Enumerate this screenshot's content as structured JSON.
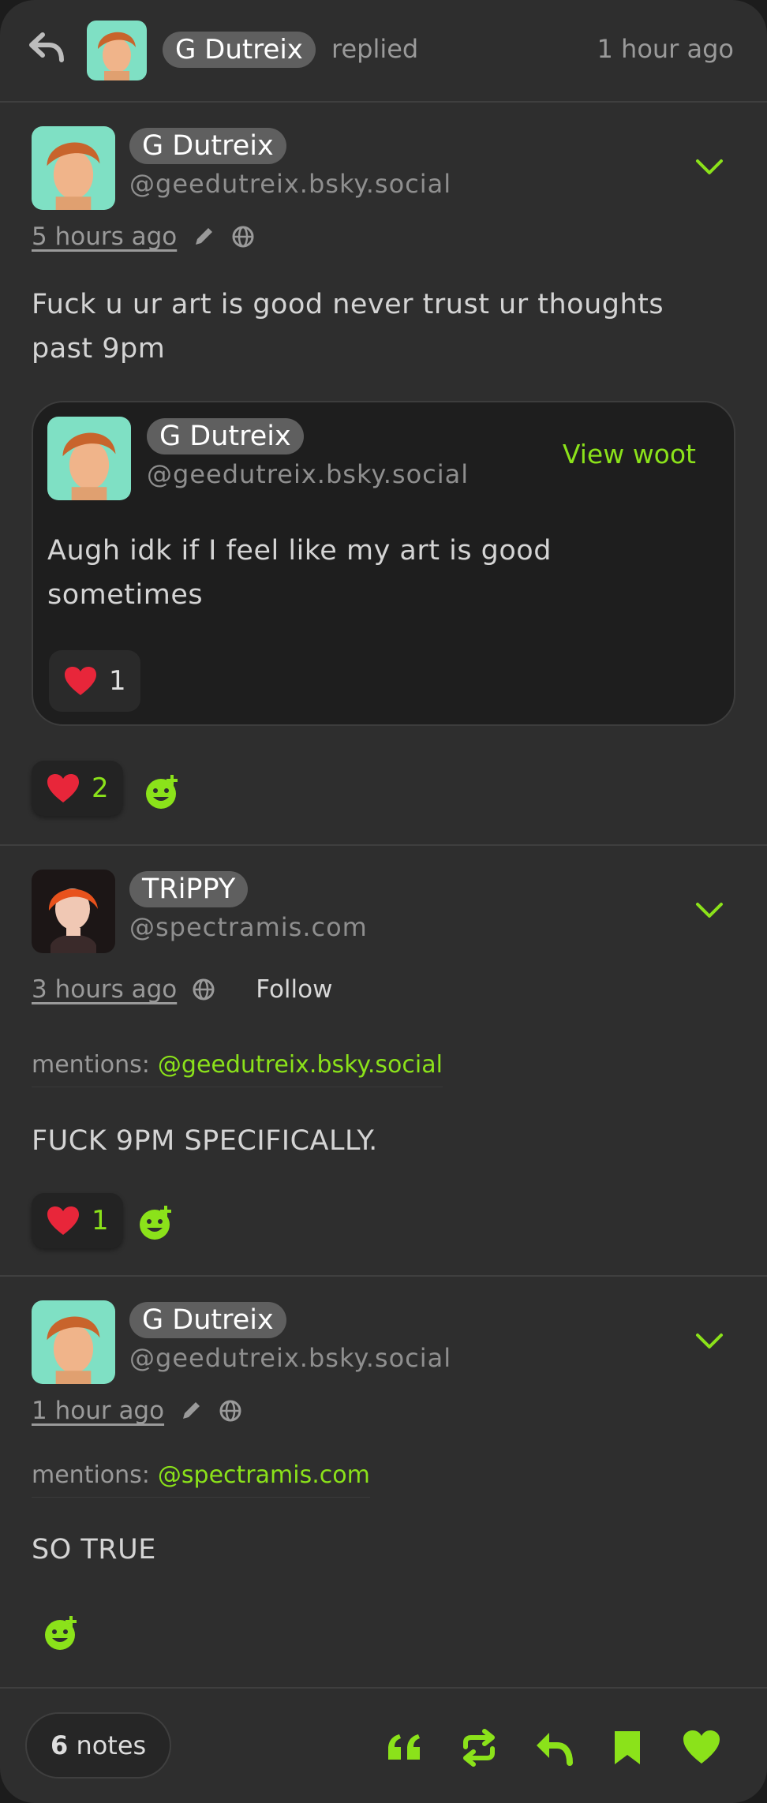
{
  "topbar": {
    "name": "G Dutreix",
    "action": "replied",
    "time": "1 hour ago"
  },
  "posts": [
    {
      "name": "G Dutreix",
      "handle": "@geedutreix.bsky.social",
      "time": "5 hours ago",
      "text": "Fuck u ur art is good never trust ur thoughts past 9pm",
      "quote": {
        "name": "G Dutreix",
        "handle": "@geedutreix.bsky.social",
        "view_label": "View woot",
        "text": "Augh idk if I feel like my art is good sometimes",
        "likes": "1"
      },
      "likes": "2"
    },
    {
      "name": "TRiPPY",
      "handle": "@spectramis.com",
      "time": "3 hours ago",
      "follow_label": "Follow",
      "mentions_label": "mentions:",
      "mention": "@geedutreix.bsky.social",
      "text": "FUCK 9PM SPECIFICALLY.",
      "likes": "1"
    },
    {
      "name": "G Dutreix",
      "handle": "@geedutreix.bsky.social",
      "time": "1 hour ago",
      "mentions_label": "mentions:",
      "mention": "@spectramis.com",
      "text": "SO TRUE"
    }
  ],
  "footer": {
    "notes_count": "6",
    "notes_label": "notes"
  },
  "colors": {
    "accent": "#8be21a",
    "background": "#2e2e2e",
    "pill": "#5f5f5f",
    "heart": "#e8263a"
  },
  "icons": [
    "back-arrow-icon",
    "chevron-down-icon",
    "pencil-icon",
    "globe-icon",
    "heart-icon",
    "add-reaction-icon",
    "quote-icon",
    "repost-icon",
    "reply-icon",
    "bookmark-icon"
  ]
}
